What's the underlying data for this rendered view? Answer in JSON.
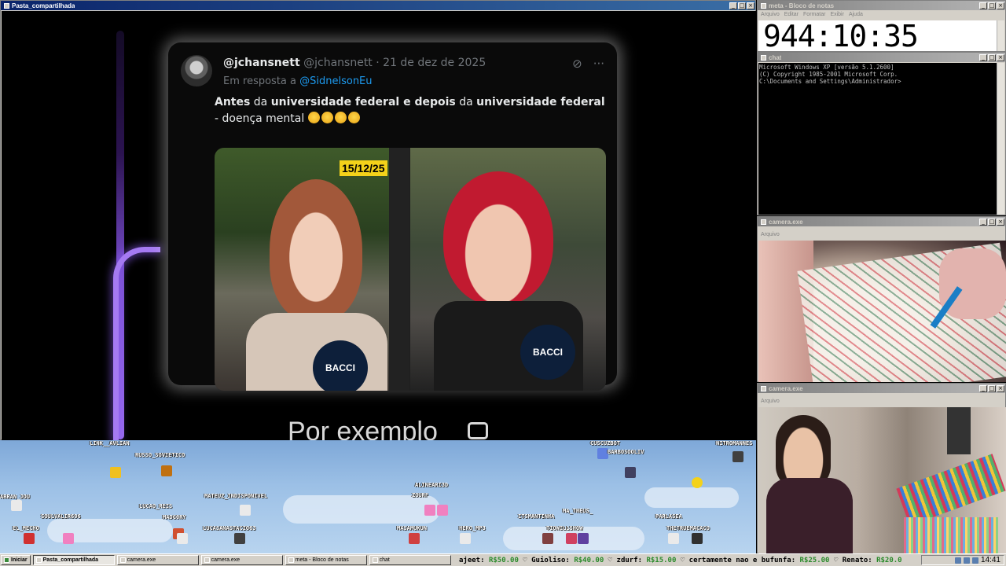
{
  "main_window": {
    "title": "Pasta_compartilhada"
  },
  "tweet": {
    "display_name": "@jchansnett",
    "handle": "@jchansnett",
    "date": "21 de dez de 2025",
    "reply_prefix": "Em resposta a",
    "reply_mention": "@SidnelsonEu",
    "text_segments": [
      {
        "t": "Antes",
        "b": true
      },
      {
        "t": " da ",
        "b": false
      },
      {
        "t": "universidade federal e depois",
        "b": true
      },
      {
        "t": " da ",
        "b": false
      },
      {
        "t": "universidade federal",
        "b": true
      },
      {
        "t": " - doença mental ",
        "b": false
      }
    ],
    "date_badge": "15/12/25",
    "mic_label": "BACCI"
  },
  "subtitle": "Por exemplo",
  "chatters": [
    {
      "name": "LINK__AVLIAN"
    },
    {
      "name": "RUSSO_SOVIETICO"
    },
    {
      "name": "ARRAN_JOU"
    },
    {
      "name": "SOULVALIR696"
    },
    {
      "name": "LUCAO_REIS"
    },
    {
      "name": "MATEUZ_INDISPONIVEL"
    },
    {
      "name": "MADG0RY"
    },
    {
      "name": "EL_MECHO"
    },
    {
      "name": "LUCASANASTACIO63"
    },
    {
      "name": "ALINEARI3D"
    },
    {
      "name": "ZOURF"
    },
    {
      "name": "MASAMUKUN"
    },
    {
      "name": "HERO_MP3"
    },
    {
      "name": "CUSCUZBOT"
    },
    {
      "name": "BARBOSOOLIV"
    },
    {
      "name": "ITSMANTINHA"
    },
    {
      "name": "MA_THEUS_"
    },
    {
      "name": "TIOWILLSHOW"
    },
    {
      "name": "PARLASEA"
    },
    {
      "name": "THETRUEMACACO"
    },
    {
      "name": "NITROMANNES"
    }
  ],
  "notepad": {
    "title": "meta - Bloco de notas",
    "menu": [
      "Arquivo",
      "Editar",
      "Formatar",
      "Exibir",
      "Ajuda"
    ],
    "content": "944:10:35"
  },
  "chat_window": {
    "title": "chat",
    "lines": [
      "Microsoft Windows XP [versão 5.1.2600]",
      "(C) Copyright 1985-2001 Microsoft Corp.",
      "",
      "C:\\Documents and Settings\\Administrador>"
    ]
  },
  "camera1": {
    "title": "camera.exe",
    "menu": "Arquivo"
  },
  "camera2": {
    "title": "camera.exe",
    "menu": "Arquivo"
  },
  "taskbar": {
    "start": "Iniciar",
    "tasks": [
      "Pasta_compartilhada",
      "camera.exe",
      "camera.exe",
      "meta - Bloco de notas",
      "chat"
    ],
    "ticker": [
      {
        "pre": "ajeet: ",
        "amt": "R$50.00"
      },
      {
        "pre": " ♡ Guioliso: ",
        "amt": "R$40.00"
      },
      {
        "pre": " ♡ zdurf: ",
        "amt": "R$15.00"
      },
      {
        "pre": " ♡ certamente nao e bufunfa: ",
        "amt": "R$25.00"
      },
      {
        "pre": " ♡ Renato: ",
        "amt": "R$20.0"
      }
    ],
    "clock": "14:41"
  }
}
